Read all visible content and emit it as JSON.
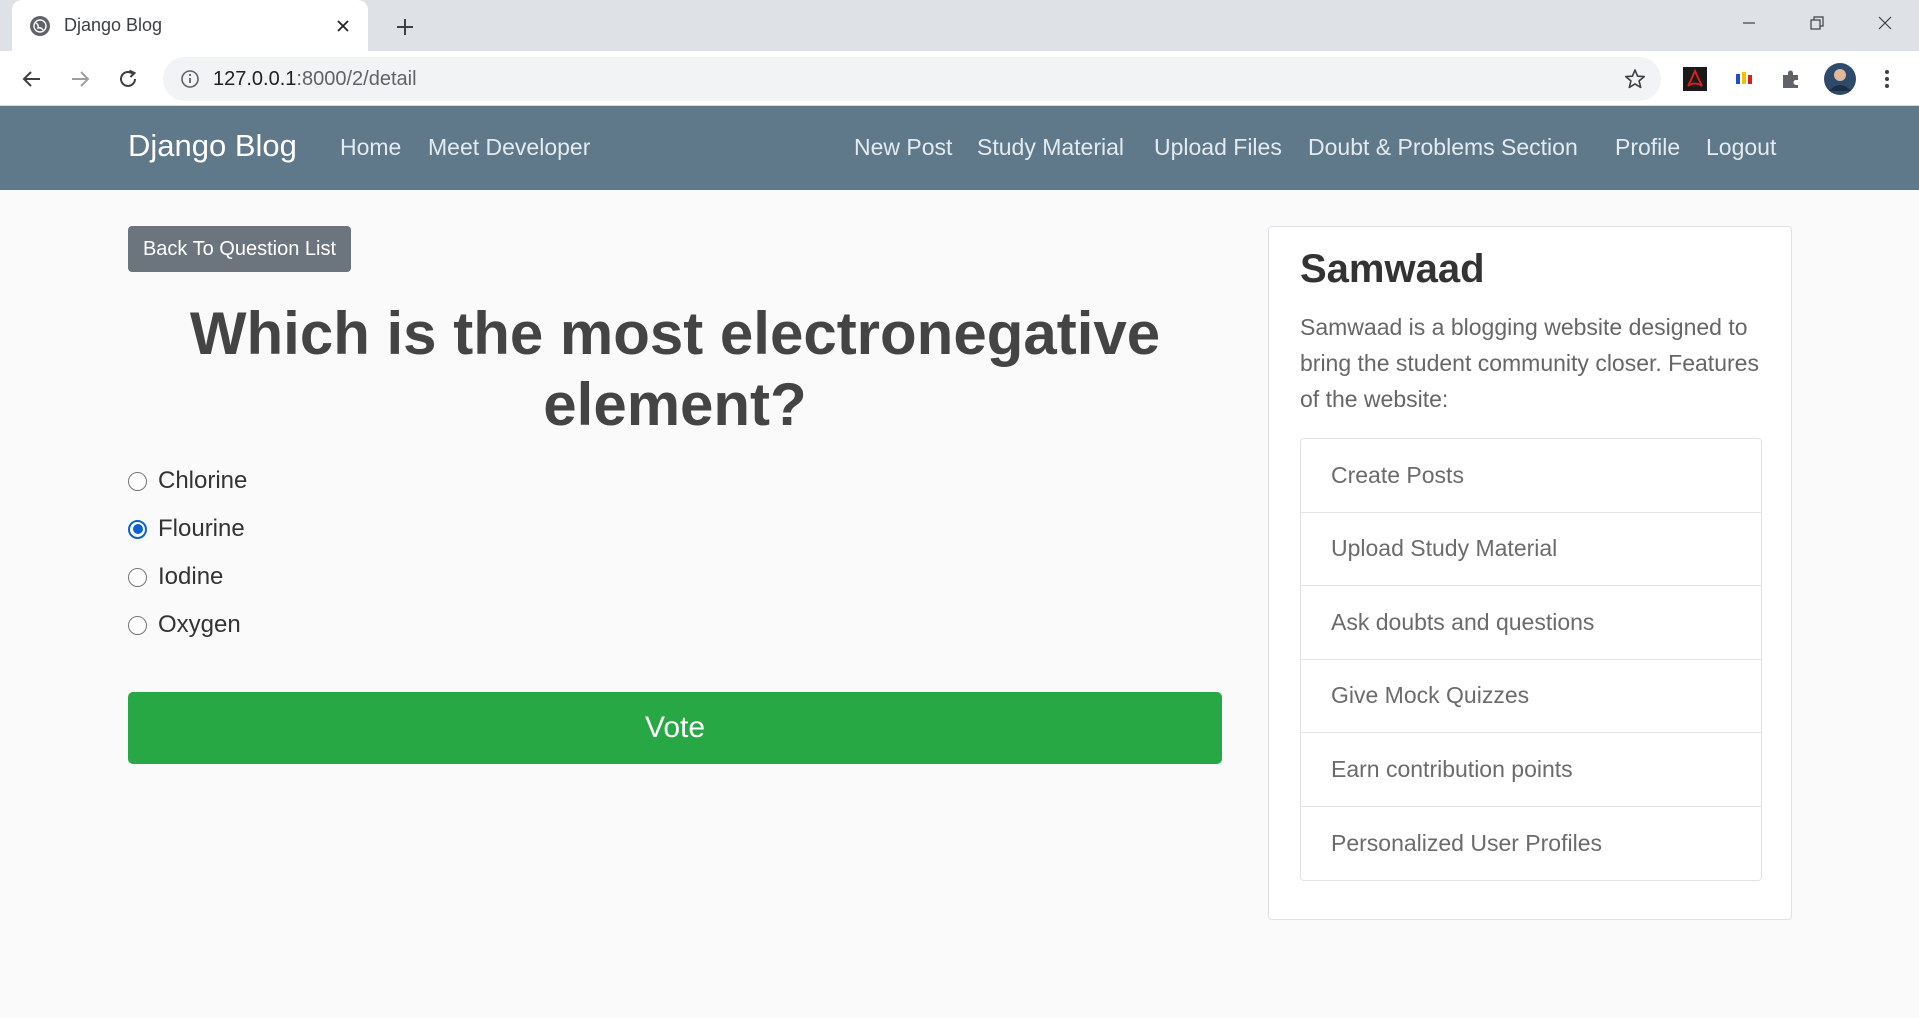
{
  "browser": {
    "tab_title": "Django Blog",
    "url_host": "127.0.0.1",
    "url_path": ":8000/2/detail"
  },
  "site": {
    "brand": "Django Blog",
    "left_links": [
      "Home",
      "Meet Developer"
    ],
    "right_links": [
      "New Post",
      "Study Material",
      "Upload Files",
      "Doubt & Problems Section",
      "Profile",
      "Logout"
    ]
  },
  "question": {
    "back_label": "Back To Question List",
    "text": "Which is the most electronegative element?",
    "options": [
      {
        "label": "Chlorine",
        "checked": false
      },
      {
        "label": "Flourine",
        "checked": true
      },
      {
        "label": "Iodine",
        "checked": false
      },
      {
        "label": "Oxygen",
        "checked": false
      }
    ],
    "vote_label": "Vote"
  },
  "sidebar": {
    "title": "Samwaad",
    "description": "Samwaad is a blogging website designed to bring the student community closer. Features of the website:",
    "features": [
      "Create Posts",
      "Upload Study Material",
      "Ask doubts and questions",
      "Give Mock Quizzes",
      "Earn contribution points",
      "Personalized User Profiles"
    ]
  },
  "icons": {
    "tab_favicon": "globe-icon",
    "tab_close": "close-icon",
    "new_tab": "plus-icon",
    "back": "arrow-left-icon",
    "forward": "arrow-right-icon",
    "reload": "reload-icon",
    "site_info": "info-icon",
    "bookmark": "star-icon",
    "ext_pdf": "pdf-extension-icon",
    "ext_colors": "color-extension-icon",
    "extensions": "puzzle-icon",
    "profile": "avatar",
    "menu": "kebab-menu-icon"
  },
  "colors": {
    "navbar": "#5f788a",
    "vote_button": "#28a745",
    "back_button": "#6c757d",
    "radio_checked": "#0b63d0"
  }
}
